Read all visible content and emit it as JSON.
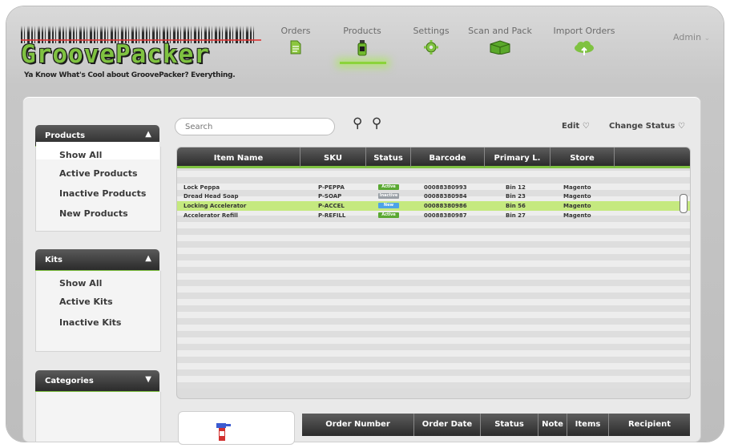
{
  "brand": {
    "logo_text": "GroovePacker",
    "tagline": "Ya Know What's Cool about GroovePacker?  Everything."
  },
  "nav": {
    "items": [
      {
        "label": "Orders",
        "icon": "document-icon"
      },
      {
        "label": "Products",
        "icon": "bottle-icon",
        "selected": true
      },
      {
        "label": "Settings",
        "icon": "gear-icon"
      },
      {
        "label": "Scan and Pack",
        "icon": "box-icon"
      },
      {
        "label": "Import Orders",
        "icon": "cloud-upload-icon"
      }
    ],
    "admin": "Admin"
  },
  "sidebar": {
    "products": {
      "title": "Products",
      "items": [
        "Show All",
        "Active Products",
        "Inactive Products",
        "New Products"
      ],
      "selected": "Show All"
    },
    "kits": {
      "title": "Kits",
      "items": [
        "Show All",
        "Active Kits",
        "Inactive Kits"
      ]
    },
    "categories": {
      "title": "Categories"
    }
  },
  "toolbar": {
    "search_placeholder": "Search",
    "edit_label": "Edit",
    "change_status_label": "Change Status"
  },
  "products_table": {
    "columns": [
      "Item Name",
      "SKU",
      "Status",
      "Barcode",
      "Primary L.",
      "Store"
    ],
    "rows": [
      {
        "name": "Lock Peppa",
        "sku": "P-PEPPA",
        "status": "Active",
        "barcode": "00088380993",
        "location": "Bin 12",
        "store": "Magento"
      },
      {
        "name": "Dread Head Soap",
        "sku": "P-SOAP",
        "status": "Inactive",
        "barcode": "00088380984",
        "location": "Bin 23",
        "store": "Magento"
      },
      {
        "name": "Locking Accelerator",
        "sku": "P-ACCEL",
        "status": "New",
        "barcode": "00088380986",
        "location": "Bin 56",
        "store": "Magento",
        "selected": true
      },
      {
        "name": "Accelerator Refill",
        "sku": "P-REFILL",
        "status": "Active",
        "barcode": "00088380987",
        "location": "Bin 27",
        "store": "Magento"
      }
    ]
  },
  "orders_table": {
    "columns": [
      "Order Number",
      "Order Date",
      "Status",
      "Note",
      "Items",
      "Recipient"
    ]
  },
  "colors": {
    "accent": "#7fc241",
    "active_badge": "#5aa832",
    "inactive_badge": "#9aa0a6",
    "new_badge": "#4da3e8",
    "selected_row": "#c5e97f"
  }
}
